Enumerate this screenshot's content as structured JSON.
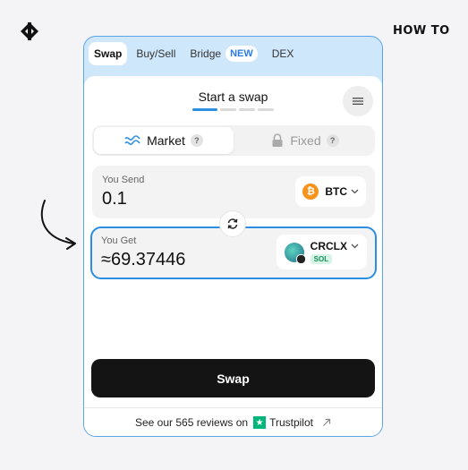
{
  "brand": {
    "icon": "brand-logo-icon",
    "howto": "HOW TO"
  },
  "tabs": [
    {
      "label": "Swap",
      "active": true
    },
    {
      "label": "Buy/Sell",
      "active": false
    },
    {
      "label": "Bridge",
      "active": false,
      "badge": "NEW"
    },
    {
      "label": "DEX",
      "active": false
    }
  ],
  "card": {
    "title": "Start a swap",
    "step": 1,
    "steps": 4
  },
  "mode": {
    "market_label": "Market",
    "fixed_label": "Fixed",
    "help": "?"
  },
  "send": {
    "label": "You Send",
    "value": "0.1",
    "coin": "BTC",
    "coin_icon_text": "₿"
  },
  "get": {
    "label": "You Get",
    "value": "≈69.37446",
    "coin": "CRCLX",
    "network": "SOL"
  },
  "swap_button": "Swap",
  "reviews": {
    "text": "See our 565 reviews on",
    "brand": "Trustpilot"
  },
  "colors": {
    "accent": "#2a8fe0",
    "frame": "#cfe7fb",
    "button": "#141414",
    "trustpilot": "#00b67a",
    "btc": "#f7931a"
  }
}
